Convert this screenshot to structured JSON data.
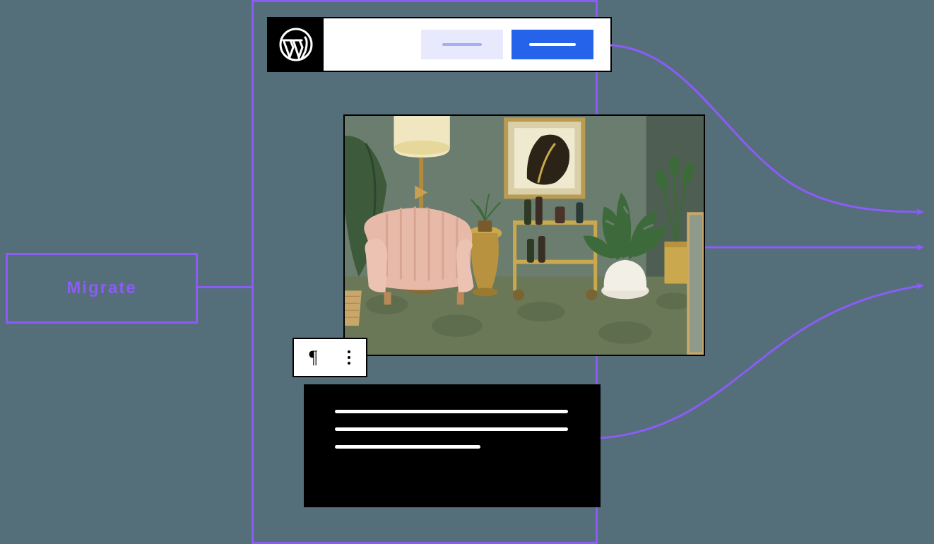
{
  "migrate": {
    "label": "Migrate"
  },
  "colors": {
    "accent": "#8b5cf6",
    "primary_button": "#2563eb",
    "secondary_button_bg": "#e8e9fc",
    "secondary_button_line": "#a5b0f0"
  },
  "icons": {
    "wordpress": "wordpress-logo",
    "paragraph": "¶",
    "kebab": "kebab-menu"
  },
  "image": {
    "alt": "Styled living room with pink velvet armchair, brass floor lamp, bar cart, monstera plants, and framed art on a sage wall"
  }
}
